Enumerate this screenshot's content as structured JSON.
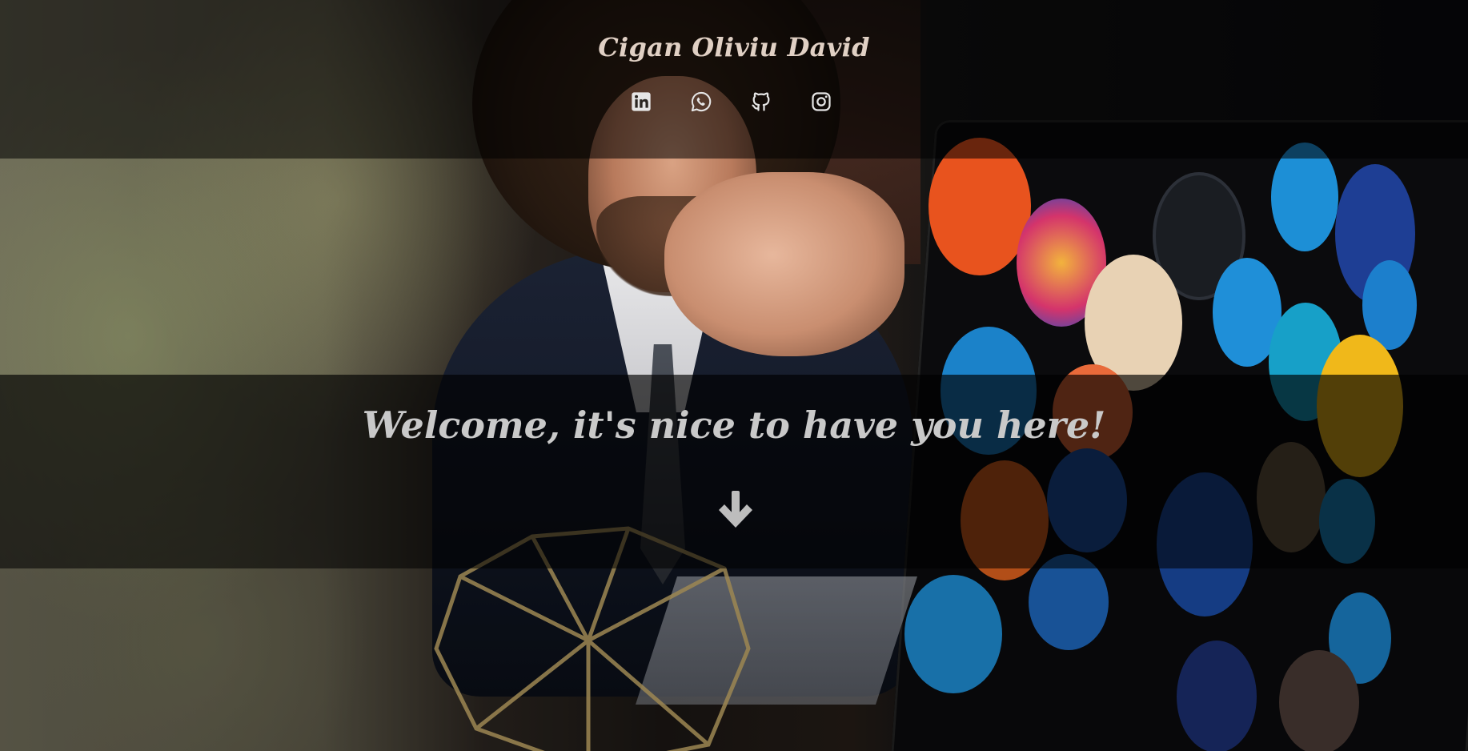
{
  "header": {
    "site_title": "Cigan Oliviu David"
  },
  "social_links": [
    {
      "icon": "linkedin-icon",
      "label": ""
    },
    {
      "icon": "whatsapp-icon",
      "label": ""
    },
    {
      "icon": "github-icon",
      "label": ""
    },
    {
      "icon": "instagram-icon",
      "label": ""
    }
  ],
  "hero": {
    "welcome_text": "Welcome, it's nice to have you here!",
    "scroll_icon": "arrow-down-icon"
  },
  "colors": {
    "title_text": "#e0d0c4",
    "welcome_text": "#c9c9c9",
    "icon_color": "#e6e6e6"
  }
}
